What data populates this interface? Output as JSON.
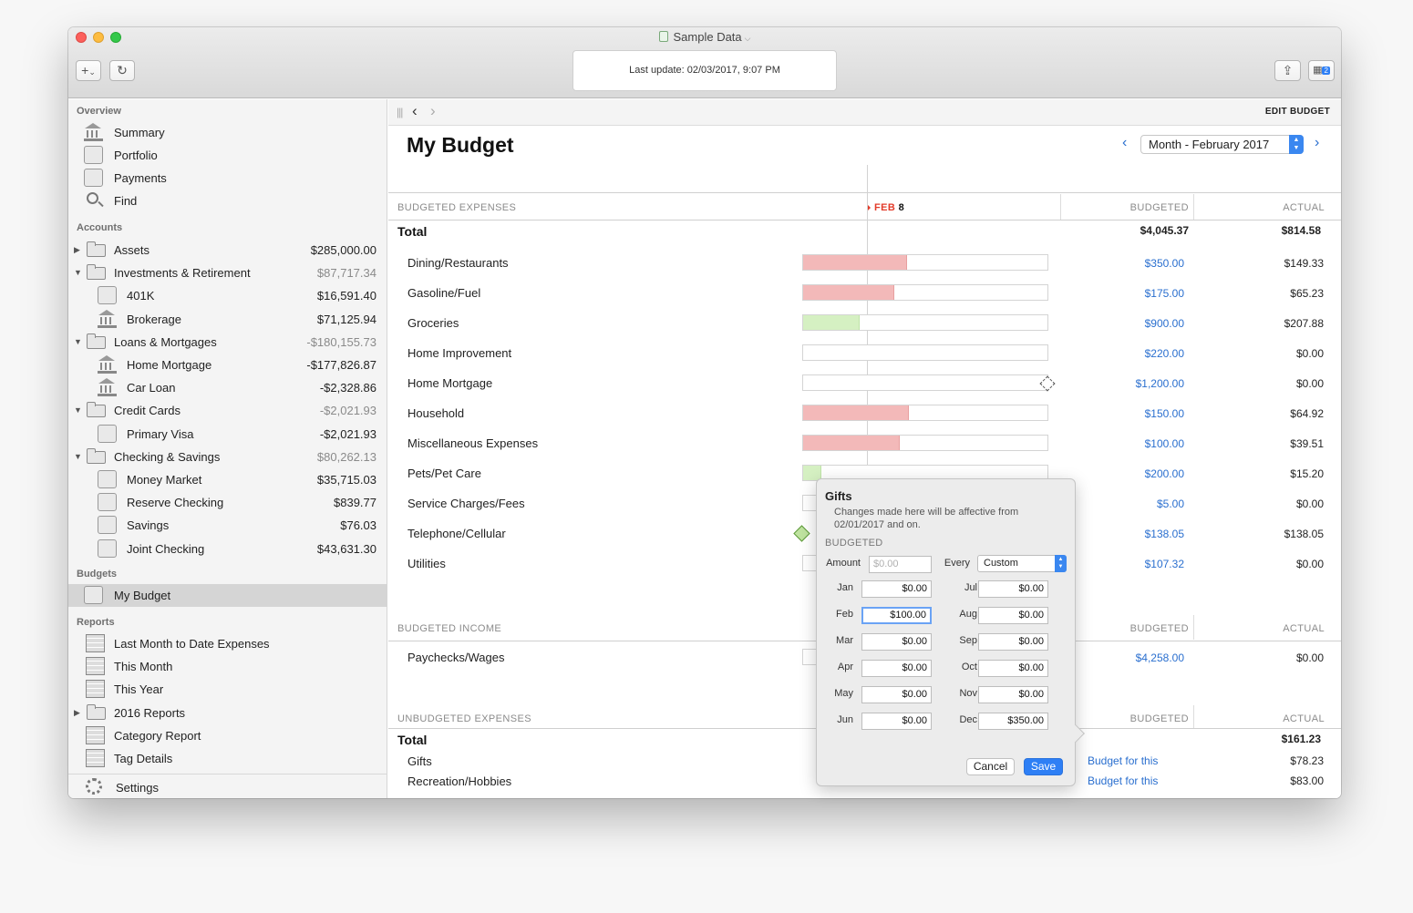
{
  "window": {
    "title": "Sample Data",
    "status": "Last update:  02/03/2017, 9:07 PM",
    "toolbar": {
      "add_label": "+",
      "refresh_icon": "refresh-icon",
      "badge": "2"
    }
  },
  "sidebar": {
    "overview_header": "Overview",
    "overview": [
      "Summary",
      "Portfolio",
      "Payments",
      "Find"
    ],
    "accounts_header": "Accounts",
    "accounts": [
      {
        "label": "Assets",
        "amount": "$285,000.00"
      },
      {
        "label": "Investments & Retirement",
        "amount": "$87,717.34"
      },
      {
        "label": "401K",
        "amount": "$16,591.40"
      },
      {
        "label": "Brokerage",
        "amount": "$71,125.94"
      },
      {
        "label": "Loans & Mortgages",
        "amount": "-$180,155.73"
      },
      {
        "label": "Home Mortgage",
        "amount": "-$177,826.87"
      },
      {
        "label": "Car Loan",
        "amount": "-$2,328.86"
      },
      {
        "label": "Credit Cards",
        "amount": "-$2,021.93"
      },
      {
        "label": "Primary Visa",
        "amount": "-$2,021.93"
      },
      {
        "label": "Checking & Savings",
        "amount": "$80,262.13"
      },
      {
        "label": "Money Market",
        "amount": "$35,715.03"
      },
      {
        "label": "Reserve Checking",
        "amount": "$839.77"
      },
      {
        "label": "Savings",
        "amount": "$76.03"
      },
      {
        "label": "Joint Checking",
        "amount": "$43,631.30"
      }
    ],
    "budgets_header": "Budgets",
    "budgets": [
      "My Budget"
    ],
    "reports_header": "Reports",
    "reports": [
      "Last Month to Date Expenses",
      "This Month",
      "This Year",
      "2016 Reports",
      "Category Report",
      "Tag Details"
    ],
    "settings": "Settings"
  },
  "main": {
    "edit_budget": "EDIT BUDGET",
    "title": "My Budget",
    "period": "Month - February 2017",
    "today_month": "FEB",
    "today_day": "8",
    "expenses": {
      "header": "BUDGETED EXPENSES",
      "col_budgeted": "BUDGETED",
      "col_actual": "ACTUAL",
      "total_label": "Total",
      "total_budgeted": "$4,045.37",
      "total_actual": "$814.58",
      "rows": [
        {
          "label": "Dining/Restaurants",
          "budgeted": "$350.00",
          "actual": "$149.33",
          "progress": 0.427
        },
        {
          "label": "Gasoline/Fuel",
          "budgeted": "$175.00",
          "actual": "$65.23",
          "progress": 0.373
        },
        {
          "label": "Groceries",
          "budgeted": "$900.00",
          "actual": "$207.88",
          "progress": 0.231
        },
        {
          "label": "Home Improvement",
          "budgeted": "$220.00",
          "actual": "$0.00",
          "progress": 0
        },
        {
          "label": "Home Mortgage",
          "budgeted": "$1,200.00",
          "actual": "$0.00",
          "progress": 0
        },
        {
          "label": "Household",
          "budgeted": "$150.00",
          "actual": "$64.92",
          "progress": 0.433
        },
        {
          "label": "Miscellaneous Expenses",
          "budgeted": "$100.00",
          "actual": "$39.51",
          "progress": 0.395
        },
        {
          "label": "Pets/Pet Care",
          "budgeted": "$200.00",
          "actual": "$15.20",
          "progress": 0.076
        },
        {
          "label": "Service Charges/Fees",
          "budgeted": "$5.00",
          "actual": "$0.00",
          "progress": 0
        },
        {
          "label": "Telephone/Cellular",
          "budgeted": "$138.05",
          "actual": "$138.05",
          "progress": 1
        },
        {
          "label": "Utilities",
          "budgeted": "$107.32",
          "actual": "$0.00",
          "progress": 0
        }
      ]
    },
    "income": {
      "header": "BUDGETED INCOME",
      "col_budgeted": "BUDGETED",
      "col_actual": "ACTUAL",
      "rows": [
        {
          "label": "Paychecks/Wages",
          "budgeted": "$4,258.00",
          "actual": "$0.00"
        }
      ]
    },
    "unbudgeted": {
      "header": "UNBUDGETED EXPENSES",
      "col_budgeted": "BUDGETED",
      "col_actual": "ACTUAL",
      "total_label": "Total",
      "total_actual": "$161.23",
      "rows": [
        {
          "label": "Gifts",
          "link": "Budget for this",
          "actual": "$78.23"
        },
        {
          "label": "Recreation/Hobbies",
          "link": "Budget for this",
          "actual": "$83.00"
        }
      ]
    }
  },
  "popover": {
    "title": "Gifts",
    "note": "Changes made here will be affective from 02/01/2017 and on.",
    "section": "BUDGETED",
    "amount_label": "Amount",
    "amount_placeholder": "$0.00",
    "every_label": "Every",
    "every_value": "Custom",
    "months": [
      {
        "label": "Jan",
        "value": "$0.00"
      },
      {
        "label": "Feb",
        "value": "$100.00"
      },
      {
        "label": "Mar",
        "value": "$0.00"
      },
      {
        "label": "Apr",
        "value": "$0.00"
      },
      {
        "label": "May",
        "value": "$0.00"
      },
      {
        "label": "Jun",
        "value": "$0.00"
      },
      {
        "label": "Jul",
        "value": "$0.00"
      },
      {
        "label": "Aug",
        "value": "$0.00"
      },
      {
        "label": "Sep",
        "value": "$0.00"
      },
      {
        "label": "Oct",
        "value": "$0.00"
      },
      {
        "label": "Nov",
        "value": "$0.00"
      },
      {
        "label": "Dec",
        "value": "$350.00"
      }
    ],
    "cancel": "Cancel",
    "save": "Save"
  },
  "colors": {
    "link": "#2a6fcf",
    "over_budget": "#f3b9b9",
    "under_budget": "#d5f0c2",
    "today": "#e33b2a"
  }
}
